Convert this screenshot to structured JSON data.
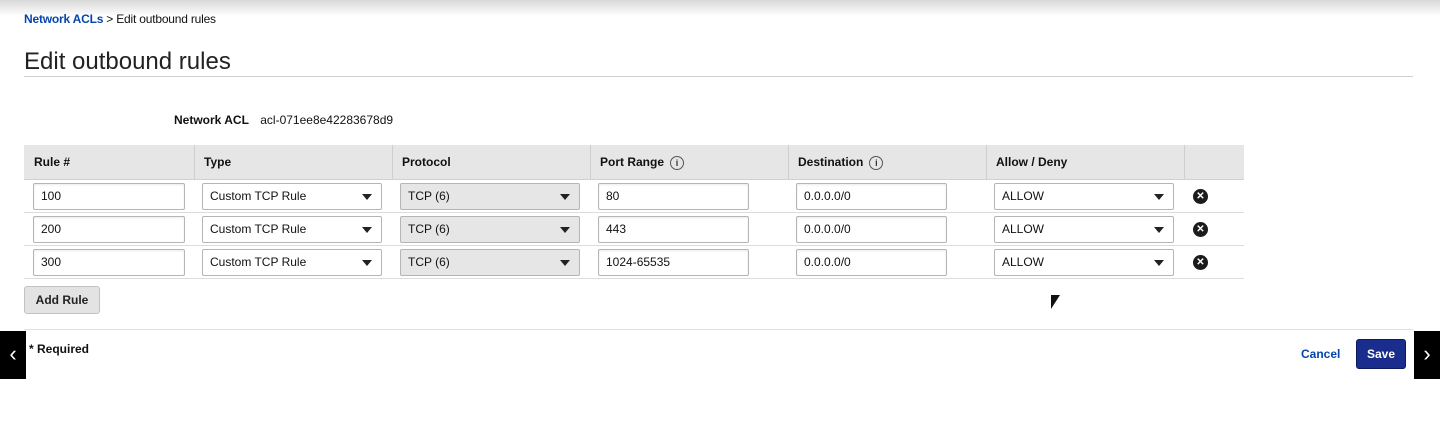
{
  "breadcrumb": {
    "link": "Network ACLs",
    "separator": " > ",
    "current": "Edit outbound rules"
  },
  "page": {
    "title": "Edit outbound rules"
  },
  "acl": {
    "label": "Network ACL",
    "id": "acl-071ee8e42283678d9"
  },
  "table": {
    "headers": {
      "rule": "Rule #",
      "type": "Type",
      "protocol": "Protocol",
      "port_range": "Port Range",
      "destination": "Destination",
      "allow_deny": "Allow / Deny"
    },
    "info_glyph": "i",
    "rows": [
      {
        "rule": "100",
        "type": "Custom TCP Rule",
        "protocol": "TCP (6)",
        "port_range": "80",
        "destination": "0.0.0.0/0",
        "action": "ALLOW"
      },
      {
        "rule": "200",
        "type": "Custom TCP Rule",
        "protocol": "TCP (6)",
        "port_range": "443",
        "destination": "0.0.0.0/0",
        "action": "ALLOW"
      },
      {
        "rule": "300",
        "type": "Custom TCP Rule",
        "protocol": "TCP (6)",
        "port_range": "1024-65535",
        "destination": "0.0.0.0/0",
        "action": "ALLOW"
      }
    ],
    "remove_glyph": "✕"
  },
  "buttons": {
    "add_rule": "Add Rule",
    "cancel": "Cancel",
    "save": "Save"
  },
  "footer": {
    "required": "* Required"
  },
  "nav": {
    "prev": "‹",
    "next": "›"
  },
  "icons": {
    "info": "info-icon",
    "dropdown": "chevron-down-icon",
    "remove": "close-circle-icon",
    "cursor": "mouse-pointer-icon"
  },
  "colors": {
    "link": "#0645ad",
    "primary": "#1a2d8c"
  }
}
